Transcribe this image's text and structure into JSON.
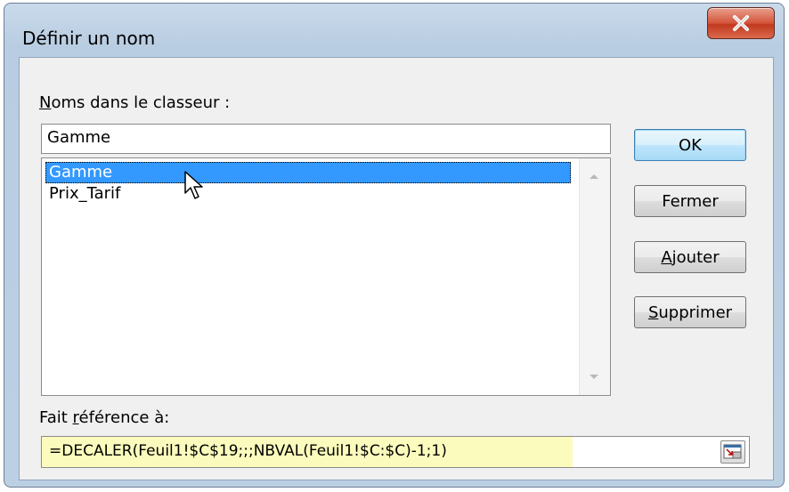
{
  "dialog": {
    "title": "Définir un nom",
    "names_label_first": "N",
    "names_label_rest": "oms dans le classeur :",
    "name_value": "Gamme",
    "names_list": [
      {
        "label": "Gamme",
        "selected": true
      },
      {
        "label": "Prix_Tarif",
        "selected": false
      }
    ],
    "refers_label_pre": "Fait ",
    "refers_label_accel": "r",
    "refers_label_post": "éférence à:",
    "refers_value": "=DECALER(Feuil1!$C$19;;;NBVAL(Feuil1!$C:$C)-1;1)",
    "buttons": {
      "ok": "OK",
      "fermer": "Fermer",
      "ajouter_accel": "A",
      "ajouter_rest": "jouter",
      "supprimer_accel": "S",
      "supprimer_rest": "upprimer"
    },
    "icons": {
      "close": "close-icon",
      "scroll_up": "scroll-up-icon",
      "scroll_down": "scroll-down-icon",
      "cursor": "mouse-pointer-icon",
      "collapse": "collapse-dialog-icon"
    },
    "colors": {
      "selection": "#3399ff",
      "formula_highlight": "#fbfbbd",
      "close_button": "#c2391f"
    }
  }
}
